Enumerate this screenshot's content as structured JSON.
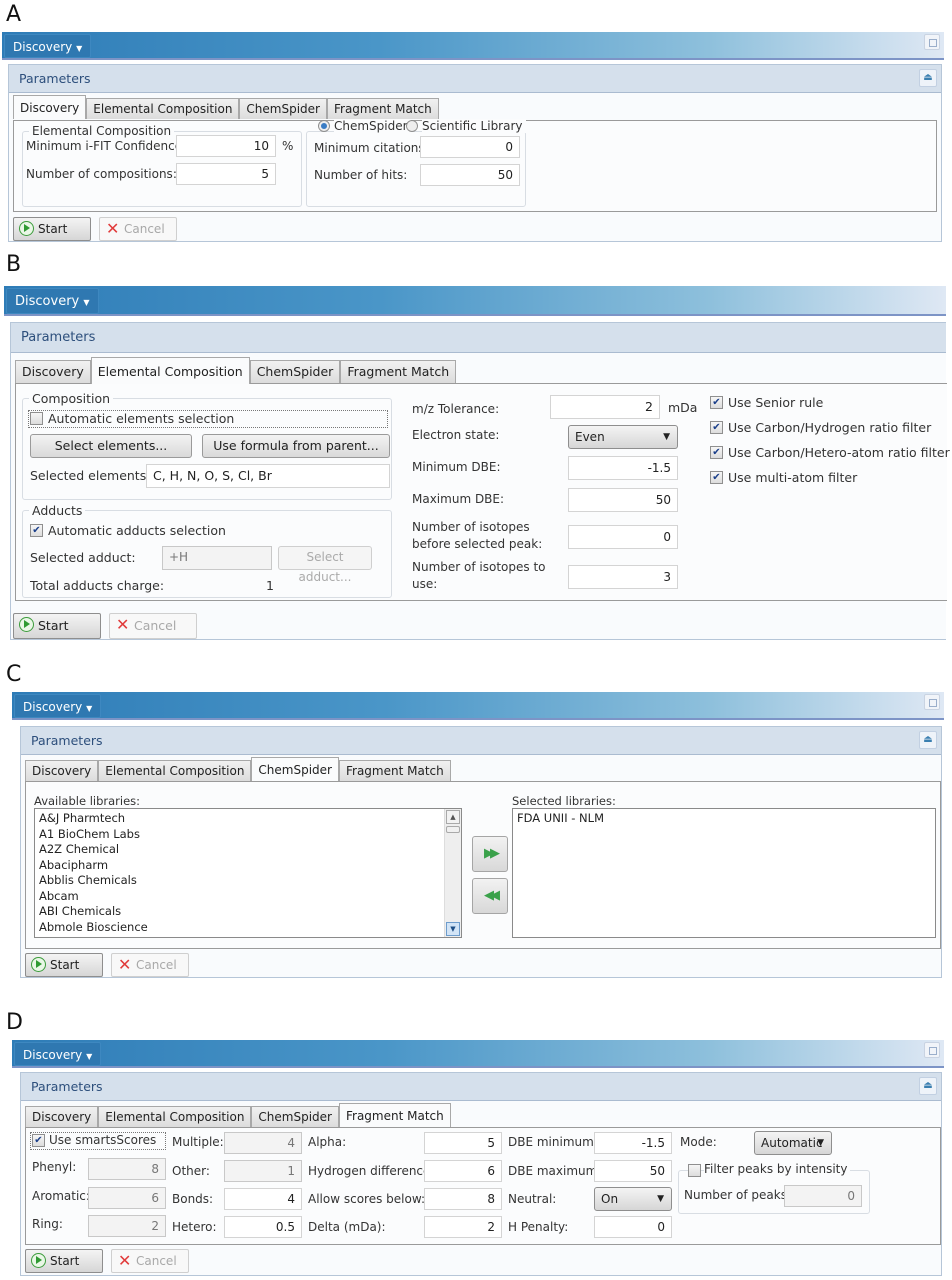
{
  "figure_labels": [
    "A",
    "B",
    "C",
    "D"
  ],
  "common": {
    "menu_label": "Discovery",
    "params_title": "Parameters",
    "tabs": [
      "Discovery",
      "Elemental Composition",
      "ChemSpider",
      "Fragment Match"
    ],
    "start_label": "Start",
    "cancel_label": "Cancel"
  },
  "panel_a": {
    "active_tab": "Discovery",
    "ec_group_title": "Elemental Composition",
    "min_ifit_label": "Minimum i-FIT Confidence:",
    "min_ifit_value": "10",
    "min_ifit_unit": "%",
    "num_compositions_label": "Number of compositions:",
    "num_compositions_value": "5",
    "radio_chemspider": "ChemSpider",
    "radio_scientific_library": "Scientific Library",
    "radio_selected": "ChemSpider",
    "min_citations_label": "Minimum citations:",
    "min_citations_value": "0",
    "num_hits_label": "Number of hits:",
    "num_hits_value": "50"
  },
  "panel_b": {
    "active_tab": "Elemental Composition",
    "composition_title": "Composition",
    "auto_elements_label": "Automatic elements selection",
    "auto_elements_checked": false,
    "select_elements_btn": "Select elements...",
    "use_formula_btn": "Use formula from parent...",
    "selected_elements_label": "Selected elements:",
    "selected_elements_value": "C, H, N, O, S, Cl, Br",
    "adducts_title": "Adducts",
    "auto_adducts_label": "Automatic adducts selection",
    "auto_adducts_checked": true,
    "selected_adduct_label": "Selected adduct:",
    "selected_adduct_value": "+H",
    "select_adduct_btn": "Select adduct...",
    "total_charge_label": "Total adducts charge:",
    "total_charge_value": "1",
    "mz_tol_label": "m/z Tolerance:",
    "mz_tol_value": "2",
    "mz_tol_unit": "mDa",
    "electron_state_label": "Electron state:",
    "electron_state_value": "Even",
    "min_dbe_label": "Minimum DBE:",
    "min_dbe_value": "-1.5",
    "max_dbe_label": "Maximum DBE:",
    "max_dbe_value": "50",
    "iso_before_label_1": "Number of isotopes",
    "iso_before_label_2": "before selected peak:",
    "iso_before_value": "0",
    "iso_use_label_1": "Number of isotopes to",
    "iso_use_label_2": "use:",
    "iso_use_value": "3",
    "checks": [
      {
        "label": "Use Senior rule",
        "checked": true
      },
      {
        "label": "Use Carbon/Hydrogen ratio filter",
        "checked": true
      },
      {
        "label": "Use Carbon/Hetero-atom ratio filter",
        "checked": true
      },
      {
        "label": "Use multi-atom filter",
        "checked": true
      }
    ]
  },
  "panel_c": {
    "active_tab": "ChemSpider",
    "available_label": "Available libraries:",
    "available": [
      "A&J Pharmtech",
      "A1 BioChem Labs",
      "A2Z Chemical",
      "Abacipharm",
      "Abblis Chemicals",
      "Abcam",
      "ABI Chemicals",
      "Abmole Bioscience"
    ],
    "selected_label": "Selected libraries:",
    "selected": [
      "FDA UNII - NLM"
    ],
    "add_icon": "double-arrow-right",
    "remove_icon": "double-arrow-left"
  },
  "panel_d": {
    "active_tab": "Fragment Match",
    "use_smarts_label": "Use smartsScores",
    "use_smarts_checked": true,
    "phenyl_label": "Phenyl:",
    "phenyl_value": "8",
    "aromatic_label": "Aromatic:",
    "aromatic_value": "6",
    "ring_label": "Ring:",
    "ring_value": "2",
    "multiple_label": "Multiple:",
    "multiple_value": "4",
    "other_label": "Other:",
    "other_value": "1",
    "bonds_label": "Bonds:",
    "bonds_value": "4",
    "hetero_label": "Hetero:",
    "hetero_value": "0.5",
    "alpha_label": "Alpha:",
    "alpha_value": "5",
    "hdiff_label": "Hydrogen difference:",
    "hdiff_value": "6",
    "allow_label": "Allow scores below:",
    "allow_value": "8",
    "delta_label": "Delta (mDa):",
    "delta_value": "2",
    "dbe_min_label": "DBE minimum:",
    "dbe_min_value": "-1.5",
    "dbe_max_label": "DBE maximum:",
    "dbe_max_value": "50",
    "neutral_label": "Neutral:",
    "neutral_value": "On",
    "hpen_label": "H Penalty:",
    "hpen_value": "0",
    "mode_label": "Mode:",
    "mode_value": "Automatic",
    "filter_peaks_label": "Filter peaks by intensity",
    "filter_peaks_checked": false,
    "num_peaks_label": "Number of peaks:",
    "num_peaks_value": "0"
  }
}
